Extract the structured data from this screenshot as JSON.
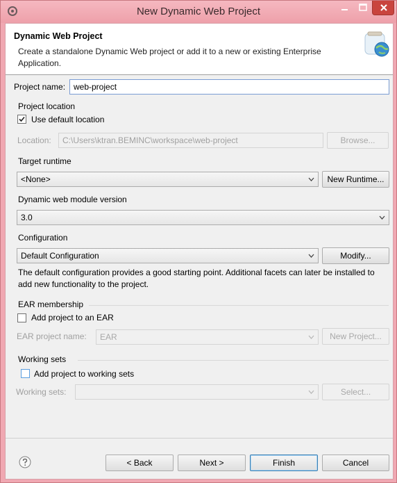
{
  "window": {
    "title": "New Dynamic Web Project",
    "accent": "#f0a8b2",
    "close_color": "#c9443e"
  },
  "header": {
    "title": "Dynamic Web Project",
    "description": "Create a standalone Dynamic Web project or add it to a new or existing Enterprise Application.",
    "icon": "web-globe-jar-icon"
  },
  "project_name": {
    "label": "Project name:",
    "value": "web-project"
  },
  "project_location": {
    "group_label": "Project location",
    "use_default_label": "Use default location",
    "use_default_checked": true,
    "location_label": "Location:",
    "location_value": "C:\\Users\\ktran.BEMINC\\workspace\\web-project",
    "browse_label": "Browse..."
  },
  "target_runtime": {
    "label": "Target runtime",
    "selected": "<None>",
    "new_runtime_label": "New Runtime..."
  },
  "module_version": {
    "label": "Dynamic web module version",
    "selected": "3.0"
  },
  "configuration": {
    "label": "Configuration",
    "selected": "Default Configuration",
    "modify_label": "Modify...",
    "description": "The default configuration provides a good starting point. Additional facets can later be installed to add new functionality to the project."
  },
  "ear": {
    "group_label": "EAR membership",
    "add_label": "Add project to an EAR",
    "add_checked": false,
    "name_label": "EAR project name:",
    "name_value": "EAR",
    "new_project_label": "New Project..."
  },
  "working_sets": {
    "group_label": "Working sets",
    "add_label": "Add project to working sets",
    "add_checked": false,
    "sets_label": "Working sets:",
    "sets_value": "",
    "select_label": "Select..."
  },
  "footer": {
    "back_label": "< Back",
    "next_label": "Next >",
    "finish_label": "Finish",
    "cancel_label": "Cancel"
  }
}
